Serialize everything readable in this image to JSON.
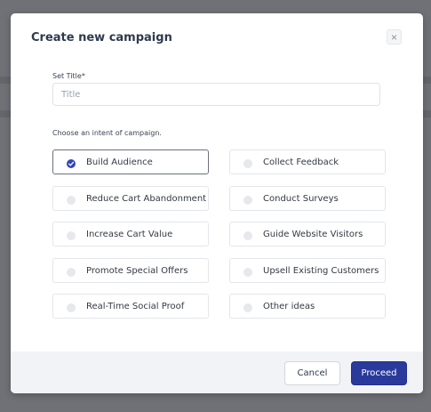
{
  "modal": {
    "title": "Create new campaign",
    "close_label": "×"
  },
  "title_field": {
    "label": "Set Title*",
    "placeholder": "Title",
    "value": ""
  },
  "intents": {
    "label": "Choose an intent of campaign.",
    "options": [
      {
        "label": "Build Audience",
        "selected": true
      },
      {
        "label": "Collect Feedback",
        "selected": false
      },
      {
        "label": "Reduce Cart Abandonment",
        "selected": false
      },
      {
        "label": "Conduct Surveys",
        "selected": false
      },
      {
        "label": "Increase Cart Value",
        "selected": false
      },
      {
        "label": "Guide Website Visitors",
        "selected": false
      },
      {
        "label": "Promote Special Offers",
        "selected": false
      },
      {
        "label": "Upsell Existing Customers",
        "selected": false
      },
      {
        "label": "Real-Time Social Proof",
        "selected": false
      },
      {
        "label": "Other ideas",
        "selected": false
      }
    ]
  },
  "footer": {
    "cancel_label": "Cancel",
    "proceed_label": "Proceed"
  },
  "colors": {
    "primary": "#2a3a9c",
    "selected_radio": "#3347b5",
    "backdrop": "#6f7176"
  }
}
